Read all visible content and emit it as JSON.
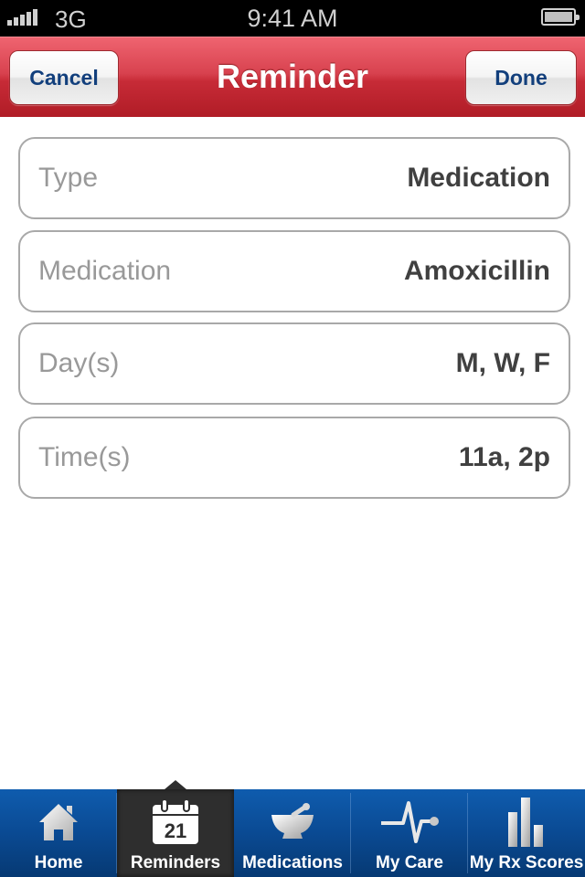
{
  "status_bar": {
    "carrier": "3G",
    "time": "9:41 AM",
    "signal_icon": "signal-bars-icon",
    "battery_icon": "battery-icon",
    "battery_level": 1.0
  },
  "nav_bar": {
    "title": "Reminder",
    "cancel_label": "Cancel",
    "done_label": "Done",
    "color": "#c72b37"
  },
  "fields": [
    {
      "label": "Type",
      "value": "Medication"
    },
    {
      "label": "Medication",
      "value": "Amoxicillin"
    },
    {
      "label": "Day(s)",
      "value": "M, W, F"
    },
    {
      "label": "Time(s)",
      "value": "11a, 2p"
    }
  ],
  "tab_bar": {
    "active_index": 1,
    "color": "#0a4a93",
    "tabs": [
      {
        "label": "Home",
        "icon": "home-icon"
      },
      {
        "label": "Reminders",
        "icon": "calendar-icon",
        "icon_text": "21"
      },
      {
        "label": "Medications",
        "icon": "mortar-pestle-icon"
      },
      {
        "label": "My Care",
        "icon": "heartbeat-icon"
      },
      {
        "label": "My Rx Scores",
        "icon": "bar-chart-icon"
      }
    ]
  }
}
